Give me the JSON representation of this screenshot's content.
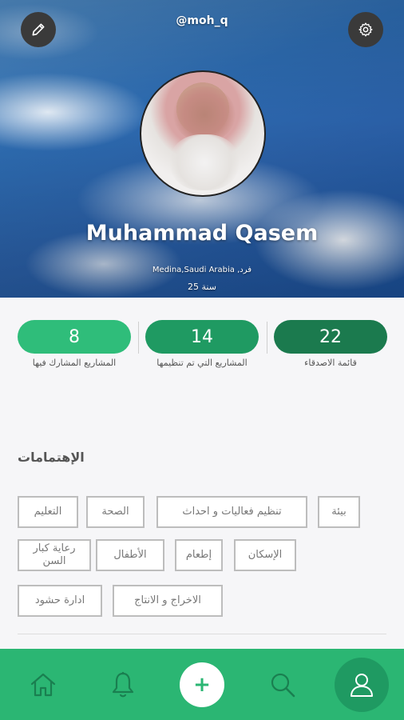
{
  "profile": {
    "handle": "@moh_q",
    "name": "Muhammad Qasem",
    "location": "Medina,Saudi Arabia ,فرد",
    "age": "25  سنة"
  },
  "stats": {
    "friends": {
      "value": "22",
      "label": "قائمة الاصدقاء"
    },
    "organized": {
      "value": "14",
      "label": "المشاريع التي تم تنظيمها"
    },
    "participated": {
      "value": "8",
      "label": "المشاريع المشارك فيها"
    }
  },
  "interests": {
    "title": "الإهتمامات",
    "tags": [
      "بيئة",
      "تنظيم فعاليات و احداث",
      "الصحة",
      "التعليم",
      "الإسكان",
      "إطعام",
      "الأطفال",
      "رعاية كبار السن",
      "الاخراج و الانتاج",
      "ادارة حشود"
    ]
  },
  "nav": {
    "add_label": "+",
    "icons": [
      "home-icon",
      "bell-icon",
      "plus-icon",
      "search-icon",
      "user-icon"
    ]
  },
  "colors": {
    "accent": "#2bb673",
    "friends": "#1b7a4e",
    "organized": "#1f9a62",
    "participated": "#2fbd7a"
  }
}
